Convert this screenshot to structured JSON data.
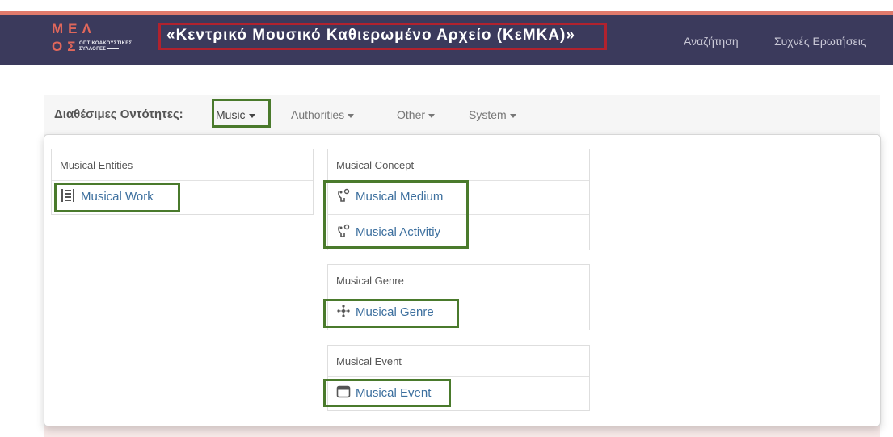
{
  "header": {
    "logo_row1": "ΜΕΛ",
    "logo_row2": "ΟΣ",
    "logo_sub1": "ΟΠΤΙΚΟΑΚΟΥΣΤΙΚΕΣ",
    "logo_sub2": "ΣΥΛΛΟΓΕΣ",
    "title": "«Κεντρικό Μουσικό Καθιερωμένο Αρχείο (ΚεΜΚΑ)»",
    "nav": [
      "Αναζήτηση",
      "Συχνές Ερωτήσεις"
    ]
  },
  "entities_bar": {
    "label": "Διαθέσιμες Οντότητες:",
    "menus": [
      "Music",
      "Authorities",
      "Other",
      "System"
    ],
    "active_menu": "Music"
  },
  "dropdown": {
    "sections": [
      {
        "title": "Musical Entities",
        "items": [
          {
            "label": "Musical Work",
            "icon": "list-icon"
          }
        ]
      },
      {
        "title": "Musical Concept",
        "items": [
          {
            "label": "Musical Medium",
            "icon": "concept-icon"
          },
          {
            "label": "Musical Activitiy",
            "icon": "concept-icon"
          }
        ]
      },
      {
        "title": "Musical Genre",
        "items": [
          {
            "label": "Musical Genre",
            "icon": "genre-icon"
          }
        ]
      },
      {
        "title": "Musical Event",
        "items": [
          {
            "label": "Musical Event",
            "icon": "calendar-icon"
          }
        ]
      }
    ]
  },
  "colors": {
    "header_bg": "#3b3a5c",
    "accent": "#e07a6c",
    "highlight_red": "#b1222e",
    "highlight_green": "#4a7a2c",
    "link": "#3c6f9e"
  }
}
